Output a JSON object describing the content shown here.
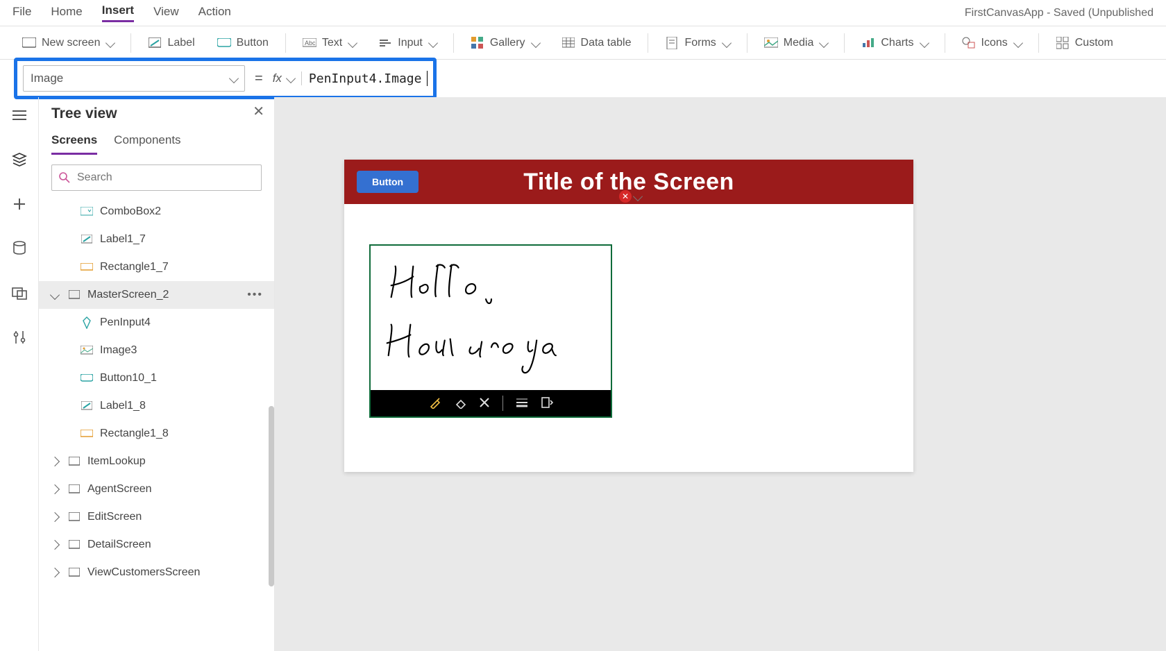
{
  "topmenu": {
    "items": [
      {
        "label": "File",
        "active": false
      },
      {
        "label": "Home",
        "active": false
      },
      {
        "label": "Insert",
        "active": true
      },
      {
        "label": "View",
        "active": false
      },
      {
        "label": "Action",
        "active": false
      }
    ],
    "app_status": "FirstCanvasApp - Saved (Unpublished"
  },
  "ribbon": {
    "items": [
      {
        "id": "new-screen",
        "label": "New screen",
        "has_chev": true
      },
      {
        "id": "label",
        "label": "Label",
        "has_chev": false
      },
      {
        "id": "button",
        "label": "Button",
        "has_chev": false
      },
      {
        "id": "text",
        "label": "Text",
        "has_chev": true
      },
      {
        "id": "input",
        "label": "Input",
        "has_chev": true
      },
      {
        "id": "gallery",
        "label": "Gallery",
        "has_chev": true
      },
      {
        "id": "datatable",
        "label": "Data table",
        "has_chev": false
      },
      {
        "id": "forms",
        "label": "Forms",
        "has_chev": true
      },
      {
        "id": "media",
        "label": "Media",
        "has_chev": true
      },
      {
        "id": "charts",
        "label": "Charts",
        "has_chev": true
      },
      {
        "id": "icons",
        "label": "Icons",
        "has_chev": true
      },
      {
        "id": "custom",
        "label": "Custom",
        "has_chev": false
      }
    ]
  },
  "formula": {
    "property": "Image",
    "equals": "=",
    "fx": "fx",
    "value": "PenInput4.Image"
  },
  "rail": {
    "items": [
      {
        "id": "hamburger"
      },
      {
        "id": "tree",
        "active": true
      },
      {
        "id": "insert"
      },
      {
        "id": "data"
      },
      {
        "id": "media"
      },
      {
        "id": "advanced"
      }
    ]
  },
  "treepane": {
    "title": "Tree view",
    "close": "✕",
    "tabs": [
      {
        "label": "Screens",
        "active": true
      },
      {
        "label": "Components",
        "active": false
      }
    ],
    "search_placeholder": "Search",
    "nodes": [
      {
        "label": "ComboBox2",
        "kind": "combo",
        "depth": 1
      },
      {
        "label": "Label1_7",
        "kind": "label",
        "depth": 1
      },
      {
        "label": "Rectangle1_7",
        "kind": "rect",
        "depth": 1
      },
      {
        "label": "MasterScreen_2",
        "kind": "screen",
        "depth": 0,
        "expanded": true,
        "selected": true
      },
      {
        "label": "PenInput4",
        "kind": "pen",
        "depth": 1
      },
      {
        "label": "Image3",
        "kind": "image",
        "depth": 1
      },
      {
        "label": "Button10_1",
        "kind": "button",
        "depth": 1
      },
      {
        "label": "Label1_8",
        "kind": "label",
        "depth": 1
      },
      {
        "label": "Rectangle1_8",
        "kind": "rect",
        "depth": 1
      },
      {
        "label": "ItemLookup",
        "kind": "screen",
        "depth": 0,
        "expanded": false
      },
      {
        "label": "AgentScreen",
        "kind": "screen",
        "depth": 0,
        "expanded": false
      },
      {
        "label": "EditScreen",
        "kind": "screen",
        "depth": 0,
        "expanded": false
      },
      {
        "label": "DetailScreen",
        "kind": "screen",
        "depth": 0,
        "expanded": false
      },
      {
        "label": "ViewCustomersScreen",
        "kind": "screen",
        "depth": 0,
        "expanded": false
      }
    ]
  },
  "canvas": {
    "header_title": "Title of the Screen",
    "header_button": "Button",
    "pen_tools": [
      "draw",
      "erase",
      "clear",
      "lines",
      "edit"
    ]
  }
}
